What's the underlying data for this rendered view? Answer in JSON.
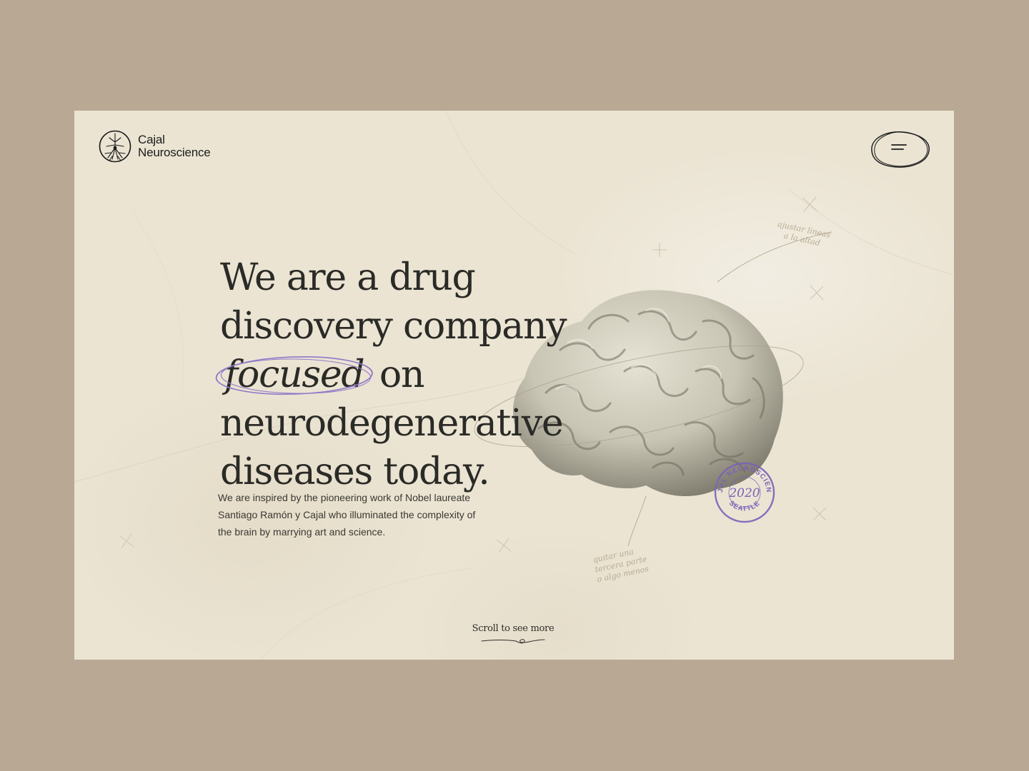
{
  "brand": {
    "line1": "Cajal",
    "line2": "Neuroscience",
    "logo_icon": "neuron-circle-icon"
  },
  "header": {
    "menu_icon": "hamburger-menu-icon"
  },
  "hero": {
    "headline_before": "We are a drug discovery company",
    "headline_emphasis": "focused",
    "headline_after": "on neurodegenerative diseases today.",
    "intro": "We are inspired by the pioneering work of Nobel laureate Santiago Ramón y Cajal who illuminated the complexity of the brain by marrying art and science."
  },
  "stamp": {
    "top_text": "CAJAL NEUROSCIENCE",
    "year": "2020",
    "bottom_text": "SEATTLE",
    "color": "#7b62b8"
  },
  "notes": {
    "top_right": "ajustar lineas\na la altad",
    "bottom": "quitar una\ntercera parte\no algo menos"
  },
  "scroll": {
    "label": "Scroll to see more"
  },
  "colors": {
    "outer_background": "#b9a894",
    "page_background": "#ebe4d3",
    "text": "#2a2a26",
    "accent": "#7b62b8"
  }
}
